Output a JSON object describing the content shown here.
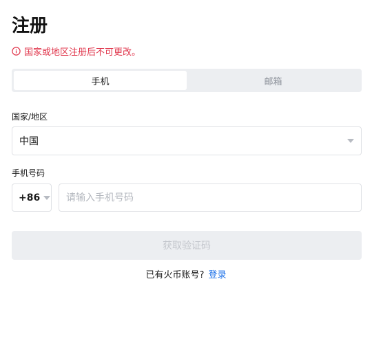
{
  "page": {
    "title": "注册"
  },
  "notice": {
    "text": "国家或地区注册后不可更改。",
    "color": "#e0354b",
    "icon": "info-icon"
  },
  "tabs": [
    {
      "label": "手机",
      "active": true
    },
    {
      "label": "邮箱",
      "active": false
    }
  ],
  "country": {
    "label": "国家/地区",
    "value": "中国"
  },
  "phone": {
    "label": "手机号码",
    "code": "+86",
    "placeholder": "请输入手机号码",
    "value": ""
  },
  "submit": {
    "label": "获取验证码",
    "disabled": true
  },
  "footer": {
    "prompt": "已有火币账号?",
    "login_link": "登录",
    "link_color": "#1a6fe8"
  }
}
